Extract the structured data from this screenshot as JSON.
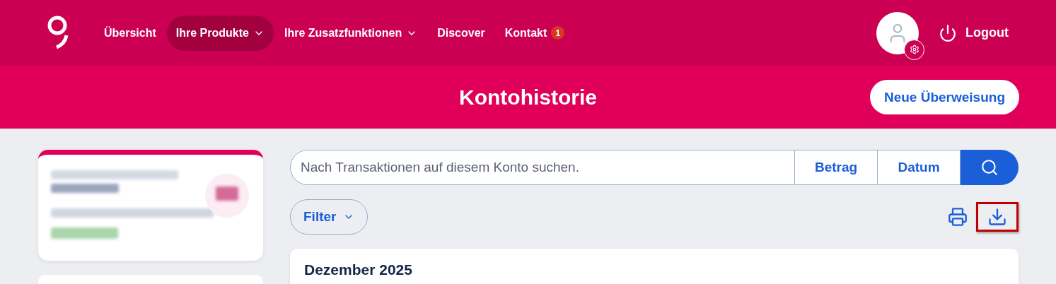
{
  "nav": {
    "items": [
      {
        "label": "Übersicht",
        "selected": false,
        "dropdown": false
      },
      {
        "label": "Ihre Produkte",
        "selected": true,
        "dropdown": true
      },
      {
        "label": "Ihre Zusatzfunktionen",
        "selected": false,
        "dropdown": true
      },
      {
        "label": "Discover",
        "selected": false,
        "dropdown": false
      },
      {
        "label": "Kontakt",
        "selected": false,
        "dropdown": false,
        "badge": "1"
      }
    ],
    "logout": "Logout"
  },
  "header": {
    "title": "Kontohistorie",
    "button": "Neue Überweisung"
  },
  "account_card": {
    "redacted": true
  },
  "search": {
    "placeholder": "Nach Transaktionen auf diesem Konto suchen.",
    "buttons": [
      "Betrag",
      "Datum"
    ]
  },
  "filter": {
    "label": "Filter"
  },
  "actions": {
    "download_highlighted": true
  },
  "month": {
    "title": "Dezember 2025"
  }
}
